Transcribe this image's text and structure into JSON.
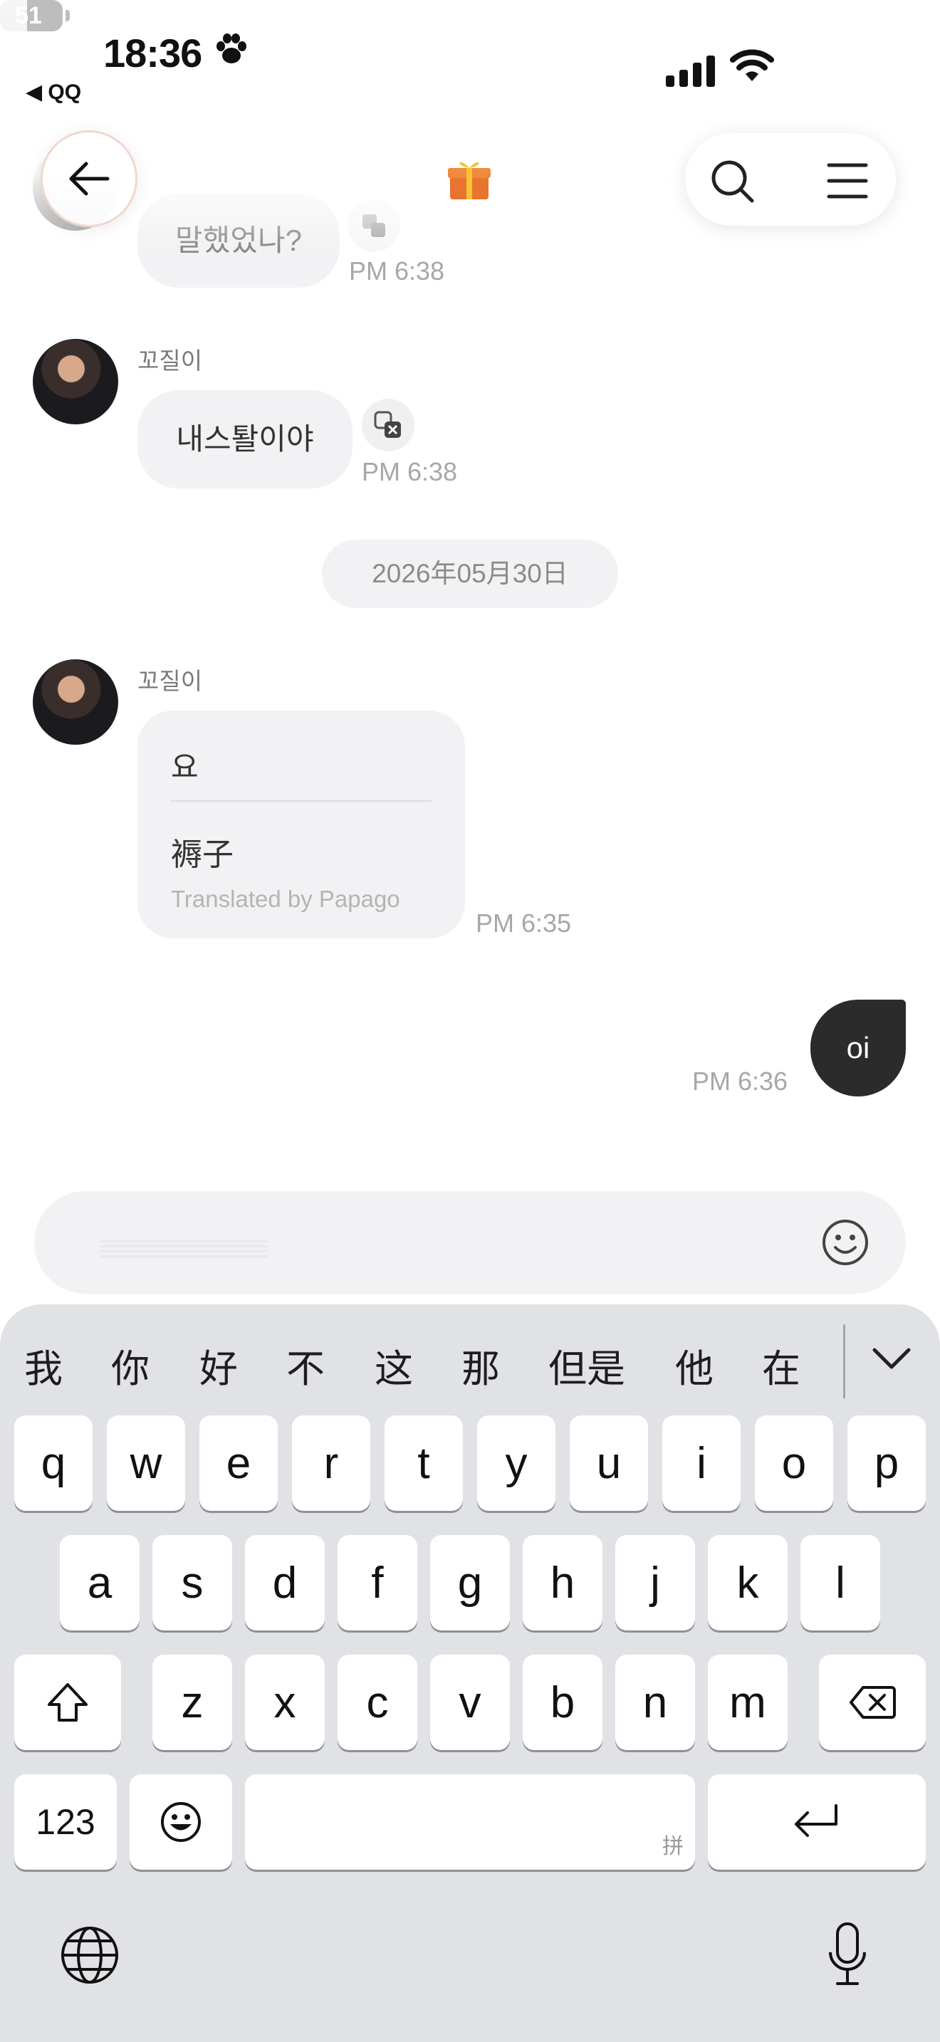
{
  "status_bar": {
    "time": "18:36",
    "back_app": "◀ QQ",
    "battery": "51"
  },
  "header": {
    "back_icon": "arrow-left-icon",
    "center_icon": "gift-icon",
    "search_icon": "search-icon",
    "menu_icon": "hamburger-menu-icon"
  },
  "messages": [
    {
      "text": "말했었나?",
      "time": "PM 6:38"
    },
    {
      "sender": "꼬질이",
      "text": "내스퇄이야",
      "time": "PM 6:38"
    },
    {
      "date": "2026年05月30日"
    },
    {
      "sender": "꼬질이",
      "original": "요",
      "translation": "褥子",
      "credit": "Translated by Papago",
      "time": "PM 6:35"
    },
    {
      "text": "oi",
      "time": "PM 6:36",
      "mine": true
    }
  ],
  "input": {
    "emoji_icon": "smiley-icon"
  },
  "keyboard": {
    "candidates": [
      "我",
      "你",
      "好",
      "不",
      "这",
      "那",
      "但是",
      "他",
      "在"
    ],
    "row1": [
      "q",
      "w",
      "e",
      "r",
      "t",
      "y",
      "u",
      "i",
      "o",
      "p"
    ],
    "row2": [
      "a",
      "s",
      "d",
      "f",
      "g",
      "h",
      "j",
      "k",
      "l"
    ],
    "row3": [
      "z",
      "x",
      "c",
      "v",
      "b",
      "n",
      "m"
    ],
    "numbers_label": "123",
    "space_hint": "拼",
    "colors": {
      "background": "#e1e2e6",
      "key": "#ffffff"
    }
  }
}
